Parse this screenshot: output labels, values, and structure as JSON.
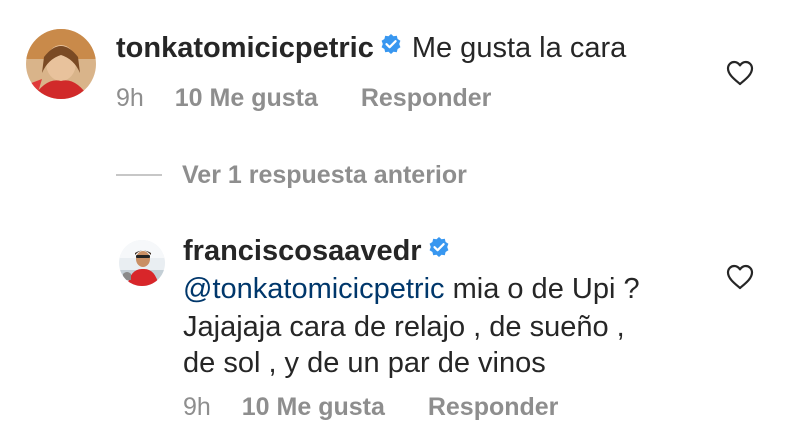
{
  "comments": [
    {
      "username": "tonkatomicicpetric",
      "verified": true,
      "text": "Me gusta la cara",
      "time": "9h",
      "likes": "10 Me gusta",
      "reply_label": "Responder",
      "avatar_icon": "user-avatar",
      "like_icon": "heart-outline-icon"
    },
    {
      "username": "franciscosaavedr",
      "verified": true,
      "mention": "@tonkatomicicpetric",
      "text_line1": " mia o de Upi ?",
      "text_line2": "Jajajaja cara de relajo , de sueño ,",
      "text_line3": "de sol , y de un par de vinos",
      "time": "9h",
      "likes": "10 Me gusta",
      "reply_label": "Responder",
      "avatar_icon": "user-avatar",
      "like_icon": "heart-outline-icon"
    }
  ],
  "view_replies": {
    "label": "Ver 1 respuesta anterior"
  },
  "colors": {
    "text": "#262626",
    "muted": "#8e8e8e",
    "verified": "#3897f0",
    "mention": "#00376b"
  }
}
